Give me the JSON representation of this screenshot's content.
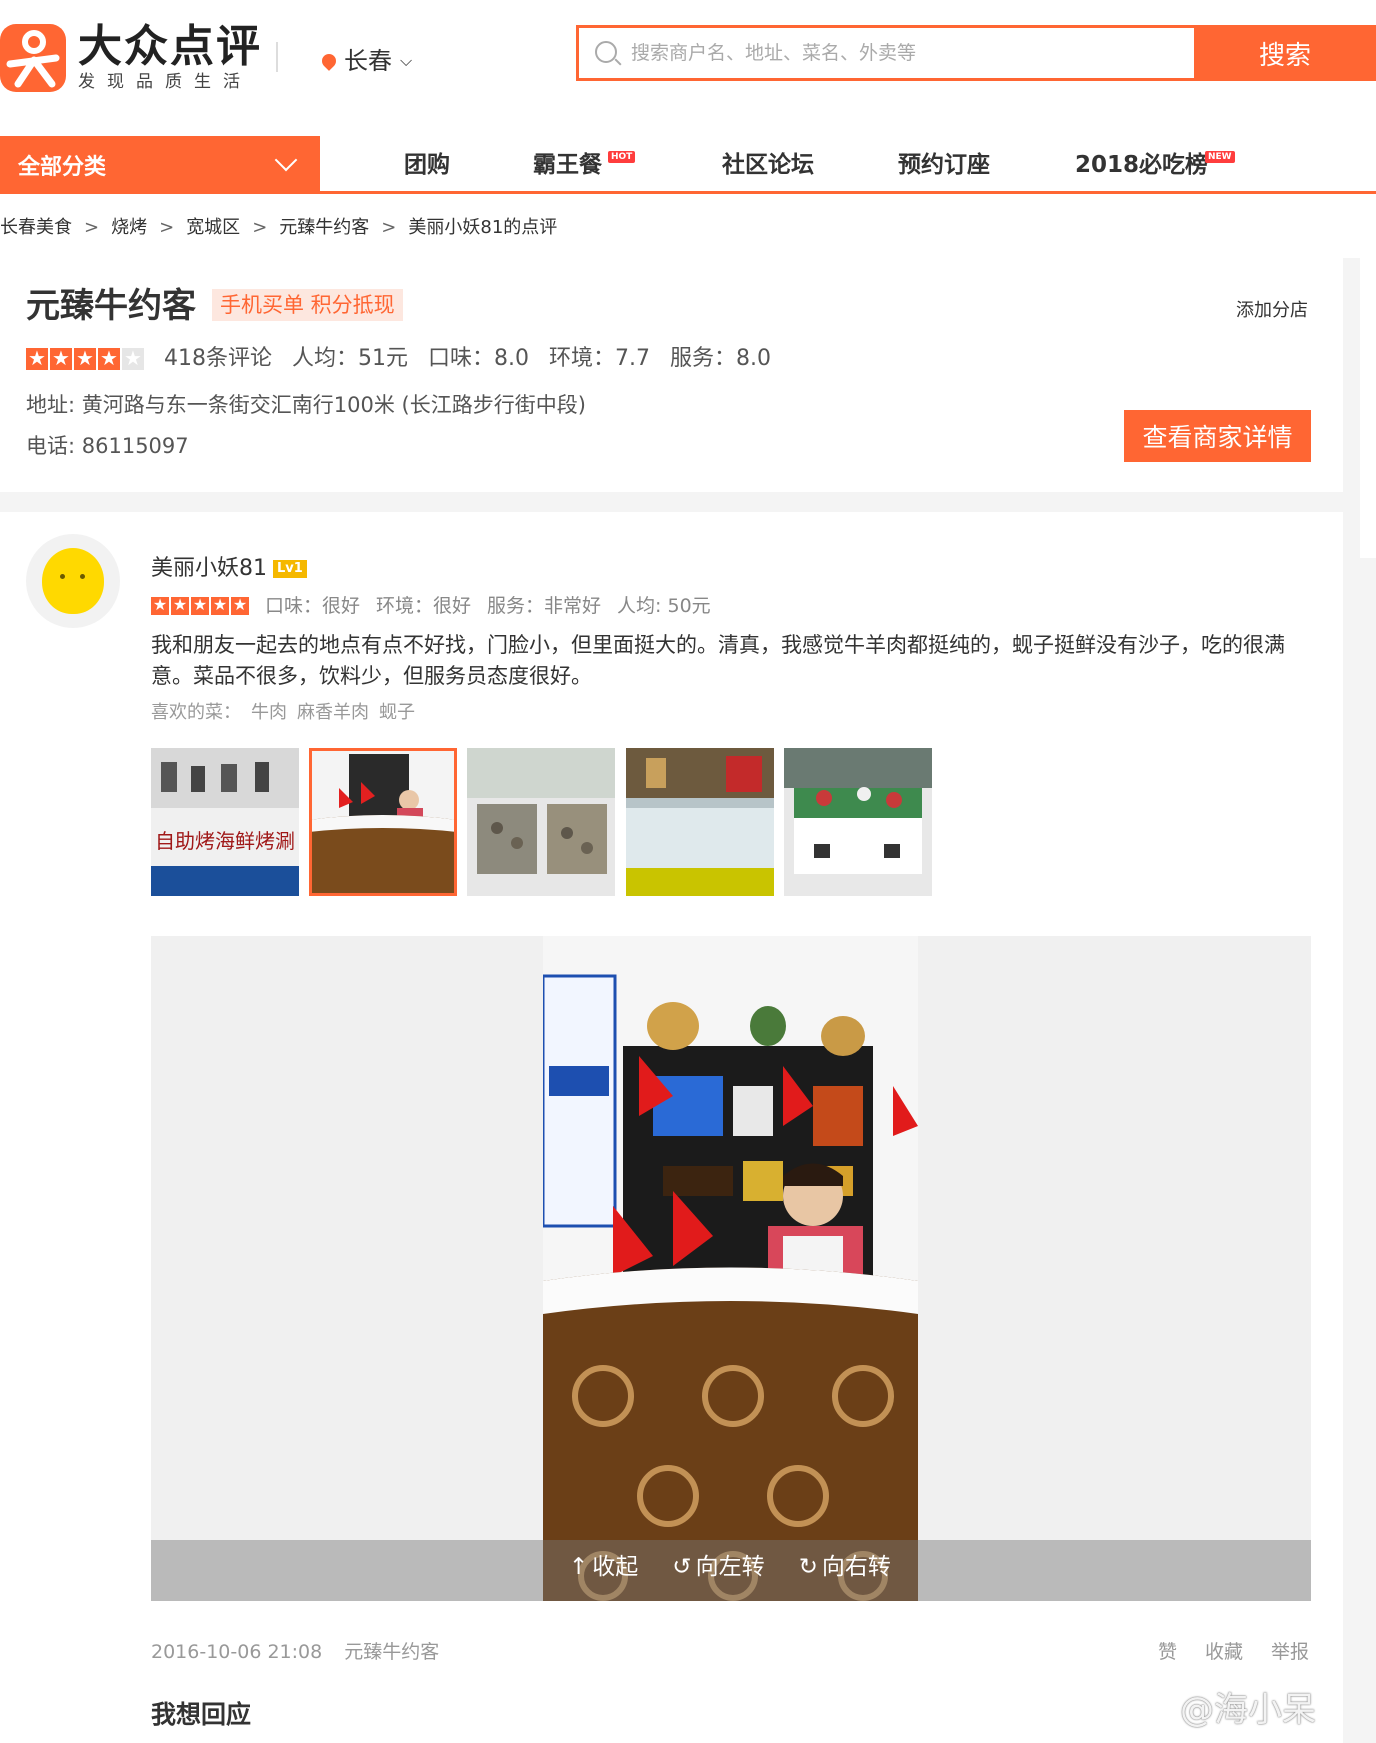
{
  "header": {
    "brand": "大众点评",
    "slogan": "发现品质生活",
    "city": "长春",
    "search_placeholder": "搜索商户名、地址、菜名、外卖等",
    "search_button": "搜索"
  },
  "nav": {
    "all_categories": "全部分类",
    "items": [
      {
        "label": "团购",
        "badge": ""
      },
      {
        "label": "霸王餐",
        "badge": "HOT"
      },
      {
        "label": "社区论坛",
        "badge": ""
      },
      {
        "label": "预约订座",
        "badge": ""
      },
      {
        "label": "2018必吃榜",
        "badge": "NEW"
      }
    ]
  },
  "breadcrumb": [
    "长春美食",
    "烧烤",
    "宽城区",
    "元臻牛约客",
    "美丽小妖81的点评"
  ],
  "breadcrumb_sep": ">",
  "shop": {
    "name": "元臻牛约客",
    "tag": "手机买单 积分抵现",
    "add_branch": "添加分店",
    "star_rating": 4,
    "reviews": "418条评论",
    "avg_price": "人均：51元",
    "taste": "口味：8.0",
    "environment": "环境：7.7",
    "service": "服务：8.0",
    "address": "地址: 黄河路与东一条街交汇南行100米 (长江路步行街中段)",
    "phone": "电话: 86115097",
    "detail_button": "查看商家详情"
  },
  "review": {
    "user": "美丽小妖81",
    "level": "Lv1",
    "star_rating": 5,
    "taste": "口味：很好",
    "environment": "环境：很好",
    "service": "服务：非常好",
    "avg_price": "人均: 50元",
    "text": "我和朋友一起去的地点有点不好找，门脸小，但里面挺大的。清真，我感觉牛羊肉都挺纯的，蚬子挺鲜没有沙子，吃的很满意。菜品不很多，饮料少，但服务员态度很好。",
    "fav_label": "喜欢的菜：",
    "fav_dishes": [
      "牛肉",
      "麻香羊肉",
      "蚬子"
    ],
    "photos": [
      {
        "name": "storefront-photo",
        "caption": "自助烤海鲜烤涮"
      },
      {
        "name": "reception-desk-photo",
        "caption": ""
      },
      {
        "name": "seafood-bins-photo",
        "caption": ""
      },
      {
        "name": "freezer-counter-photo",
        "caption": ""
      },
      {
        "name": "buffet-display-photo",
        "caption": ""
      }
    ],
    "selected_photo": 1,
    "viewer": {
      "collapse": "收起",
      "rotate_left": "向左转",
      "rotate_right": "向右转"
    },
    "date": "2016-10-06 21:08",
    "shop_ref": "元臻牛约客",
    "actions": [
      "赞",
      "收藏",
      "举报"
    ]
  },
  "reply_title": "我想回应",
  "watermark": "@海小呆",
  "colors": {
    "accent": "#ff6633",
    "level_badge": "#f5b800"
  }
}
